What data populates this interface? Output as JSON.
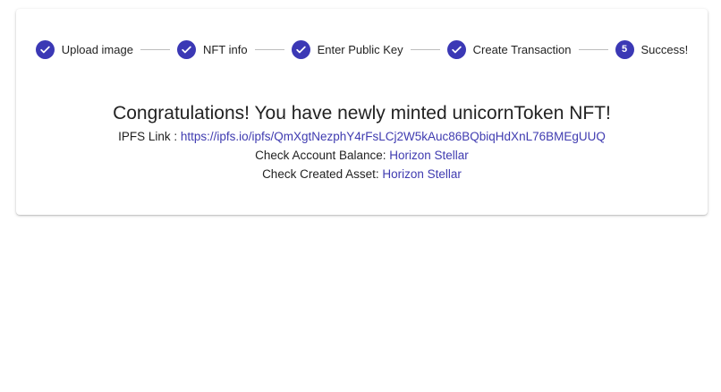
{
  "colors": {
    "accent": "#3b38b5",
    "link": "#3f3bb0",
    "text": "#222222",
    "connector": "#bdbdbd"
  },
  "stepper": {
    "steps": [
      {
        "label": "Upload image",
        "state": "completed",
        "icon": "check-icon"
      },
      {
        "label": "NFT info",
        "state": "completed",
        "icon": "check-icon"
      },
      {
        "label": "Enter Public Key",
        "state": "completed",
        "icon": "check-icon"
      },
      {
        "label": "Create Transaction",
        "state": "completed",
        "icon": "check-icon"
      },
      {
        "label": "Success!",
        "state": "active",
        "number": "5"
      }
    ]
  },
  "message": {
    "heading": "Congratulations! You have newly minted unicornToken NFT!",
    "ipfs_label": "IPFS Link : ",
    "ipfs_url": "https://ipfs.io/ipfs/QmXgtNezphY4rFsLCj2W5kAuc86BQbiqHdXnL76BMEgUUQ",
    "balance_label": "Check Account Balance: ",
    "balance_link": "Horizon Stellar",
    "asset_label": "Check Created Asset: ",
    "asset_link": "Horizon Stellar"
  }
}
